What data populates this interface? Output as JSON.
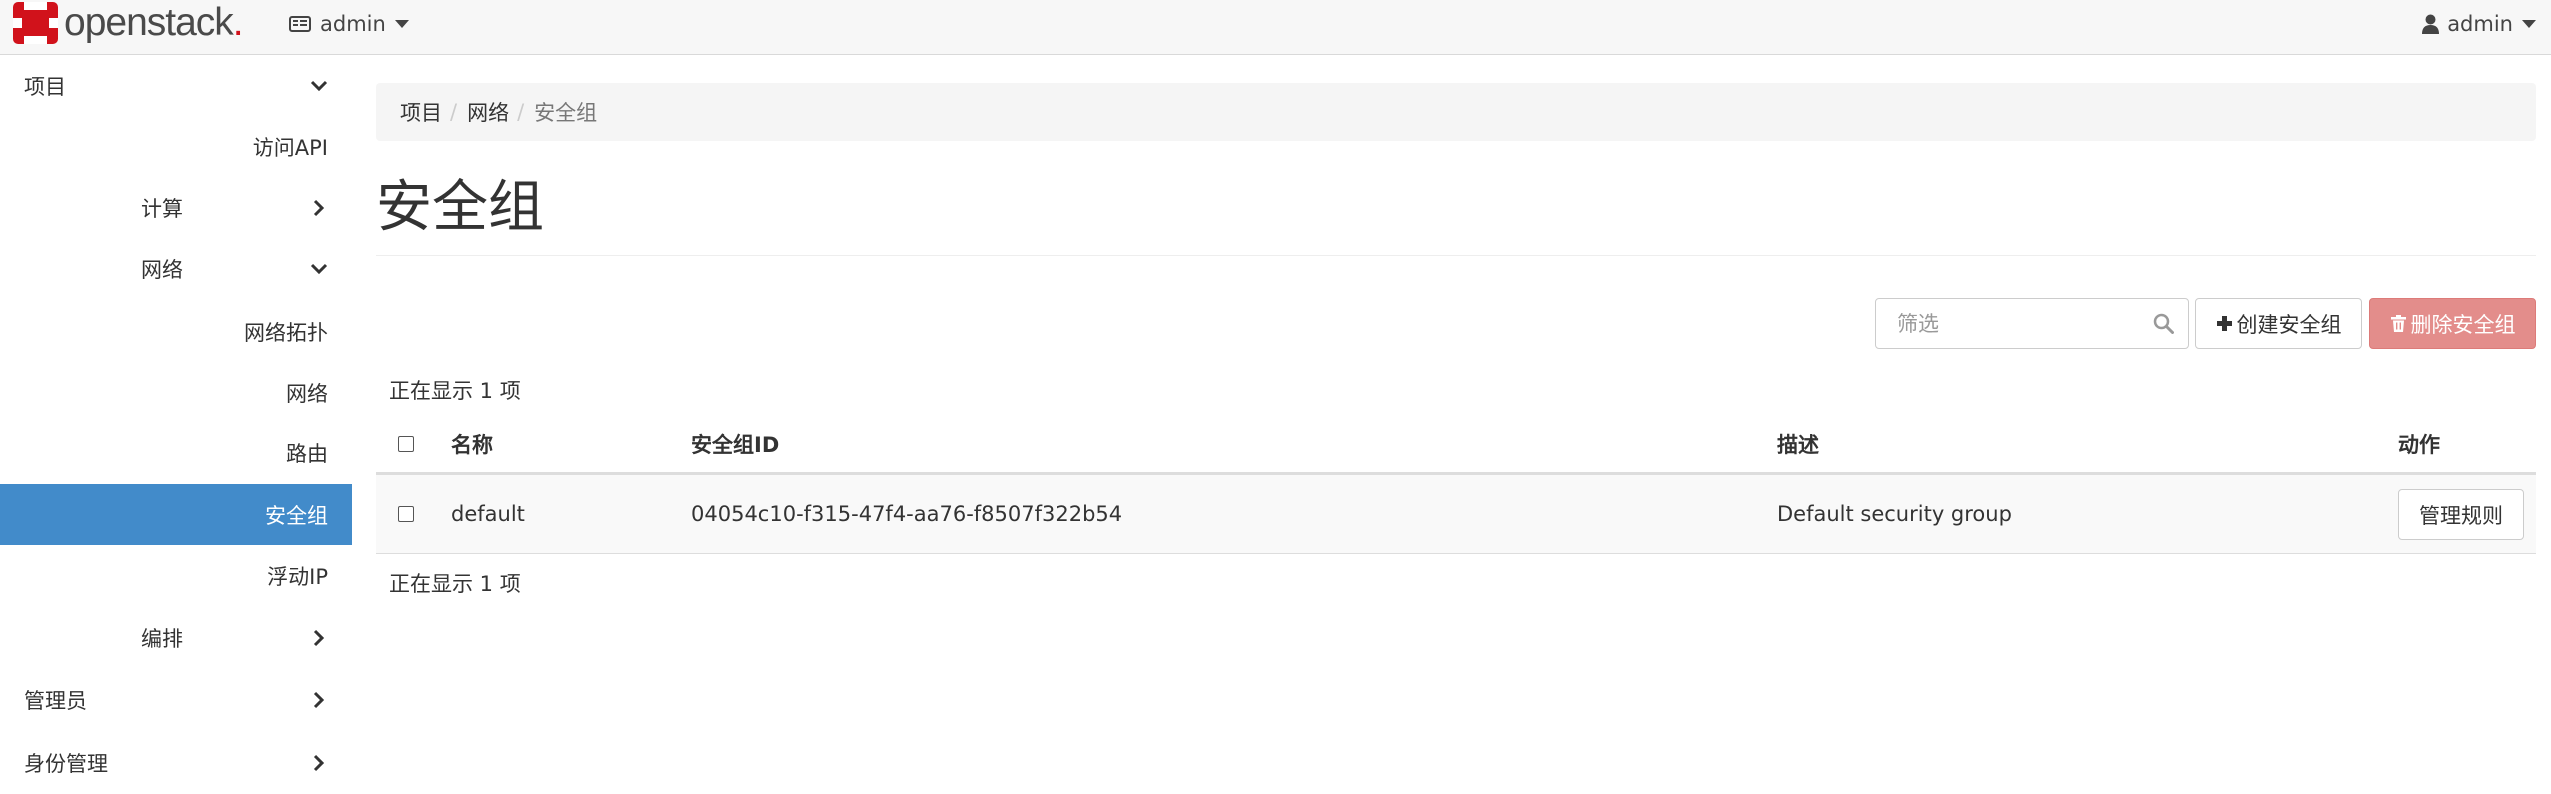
{
  "navbar": {
    "brand": {
      "name": "openstack",
      "dot": "."
    },
    "project_switcher": {
      "label": "admin",
      "icon": "project-icon"
    },
    "user_menu": {
      "label": "admin",
      "icon": "user-icon"
    }
  },
  "sidebar": {
    "items": [
      {
        "label": "项目",
        "icon": "chevron-down-icon"
      },
      {
        "label": "访问API"
      },
      {
        "label": "计算",
        "icon": "chevron-right-icon"
      },
      {
        "label": "网络",
        "icon": "chevron-down-icon"
      },
      {
        "label": "网络拓扑"
      },
      {
        "label": "网络"
      },
      {
        "label": "路由"
      },
      {
        "label": "安全组",
        "active": true
      },
      {
        "label": "浮动IP"
      },
      {
        "label": "编排",
        "icon": "chevron-right-icon"
      },
      {
        "label": "管理员",
        "icon": "chevron-right-icon"
      },
      {
        "label": "身份管理",
        "icon": "chevron-right-icon"
      }
    ]
  },
  "breadcrumb": [
    "项目",
    "网络",
    "安全组"
  ],
  "page": {
    "title": "安全组"
  },
  "toolbar": {
    "filter_placeholder": "筛选",
    "create_label": "创建安全组",
    "delete_label": "删除安全组"
  },
  "table": {
    "count_text": "正在显示 1 项",
    "headers": {
      "name": "名称",
      "id": "安全组ID",
      "description": "描述",
      "actions": "动作"
    },
    "rows": [
      {
        "name": "default",
        "id": "04054c10-f315-47f4-aa76-f8507f322b54",
        "description": "Default security group",
        "action": "管理规则"
      }
    ]
  },
  "colors": {
    "active_nav": "#428bca",
    "delete_button": "#e38d8b",
    "brand_red": "#d1121b"
  }
}
